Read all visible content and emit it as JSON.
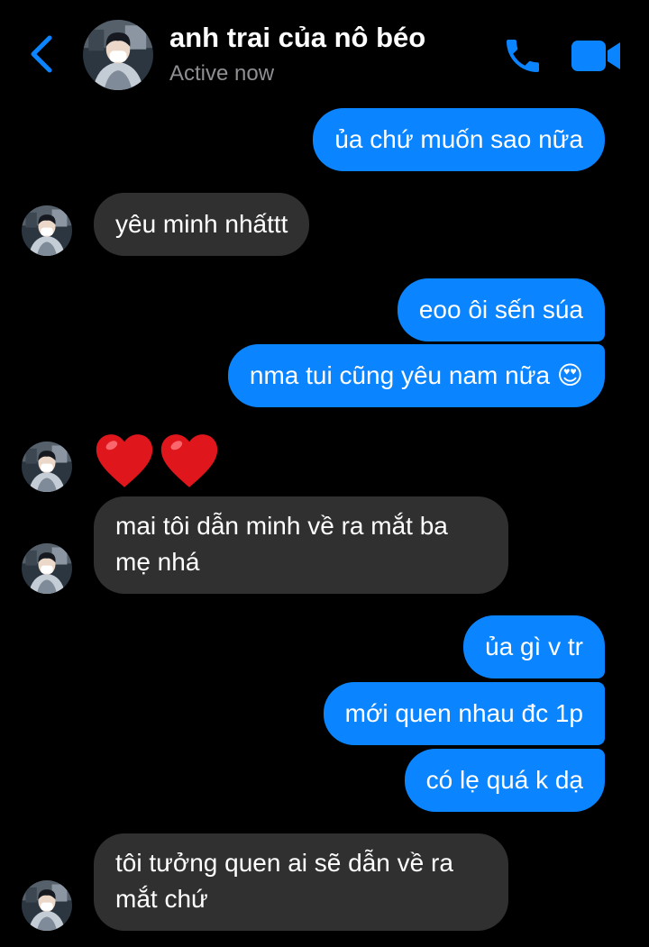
{
  "header": {
    "contact_name": "anh trai của nô béo",
    "status": "Active now",
    "back_icon": "chevron-left-icon",
    "call_icon": "phone-icon",
    "video_icon": "video-camera-icon",
    "accent_color": "#0a84ff"
  },
  "messages": [
    {
      "id": 0,
      "side": "sent",
      "text": "ủa chứ muốn sao nữa"
    },
    {
      "id": 1,
      "side": "received",
      "text": "yêu minh nhấttt"
    },
    {
      "id": 2,
      "side": "sent",
      "text": "eoo ôi sến súa"
    },
    {
      "id": 3,
      "side": "sent",
      "text": "nma tui cũng yêu nam nữa 😍"
    },
    {
      "id": 4,
      "side": "received",
      "type": "emoji",
      "emoji": "heart-icon",
      "text": "❤️❤️"
    },
    {
      "id": 5,
      "side": "received",
      "text": "mai tôi dẫn minh về ra mắt ba mẹ nhá"
    },
    {
      "id": 6,
      "side": "sent",
      "text": "ủa gì v tr"
    },
    {
      "id": 7,
      "side": "sent",
      "text": "mới quen nhau đc 1p"
    },
    {
      "id": 8,
      "side": "sent",
      "text": "có lẹ quá k dạ"
    },
    {
      "id": 9,
      "side": "received",
      "text": "tôi tưởng quen ai sẽ dẫn về ra mắt chứ"
    }
  ],
  "colors": {
    "sent_bubble": "#0a84ff",
    "received_bubble": "#303030",
    "background": "#000000",
    "secondary_text": "#8e8e93"
  }
}
